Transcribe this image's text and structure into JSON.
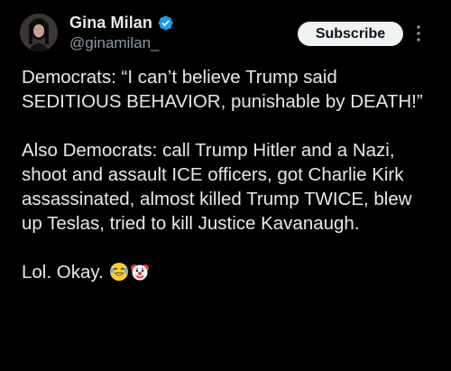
{
  "author": {
    "display_name": "Gina Milan",
    "handle": "@ginamilan_",
    "verified": true,
    "verified_color": "#1d9bf0"
  },
  "actions": {
    "subscribe_label": "Subscribe",
    "more_icon": "vertical-ellipsis-icon"
  },
  "tweet": {
    "paragraph_1": "Democrats: “I can’t believe Trump said SEDITIOUS BEHAVIOR, punishable by DEATH!”",
    "paragraph_2": "Also Democrats: call Trump Hitler and a Nazi, shoot and assault ICE officers, got Charlie Kirk assassinated, almost killed Trump TWICE, blew up Teslas, tried to kill Justice Kavanaugh.",
    "paragraph_3_text": "Lol. Okay. ",
    "emojis": [
      "laughing-tears-emoji",
      "clown-face-emoji"
    ]
  },
  "colors": {
    "background": "#000000",
    "text_primary": "#e7e9ea",
    "text_secondary": "#8b98a5",
    "button_bg": "#eff3f4"
  }
}
